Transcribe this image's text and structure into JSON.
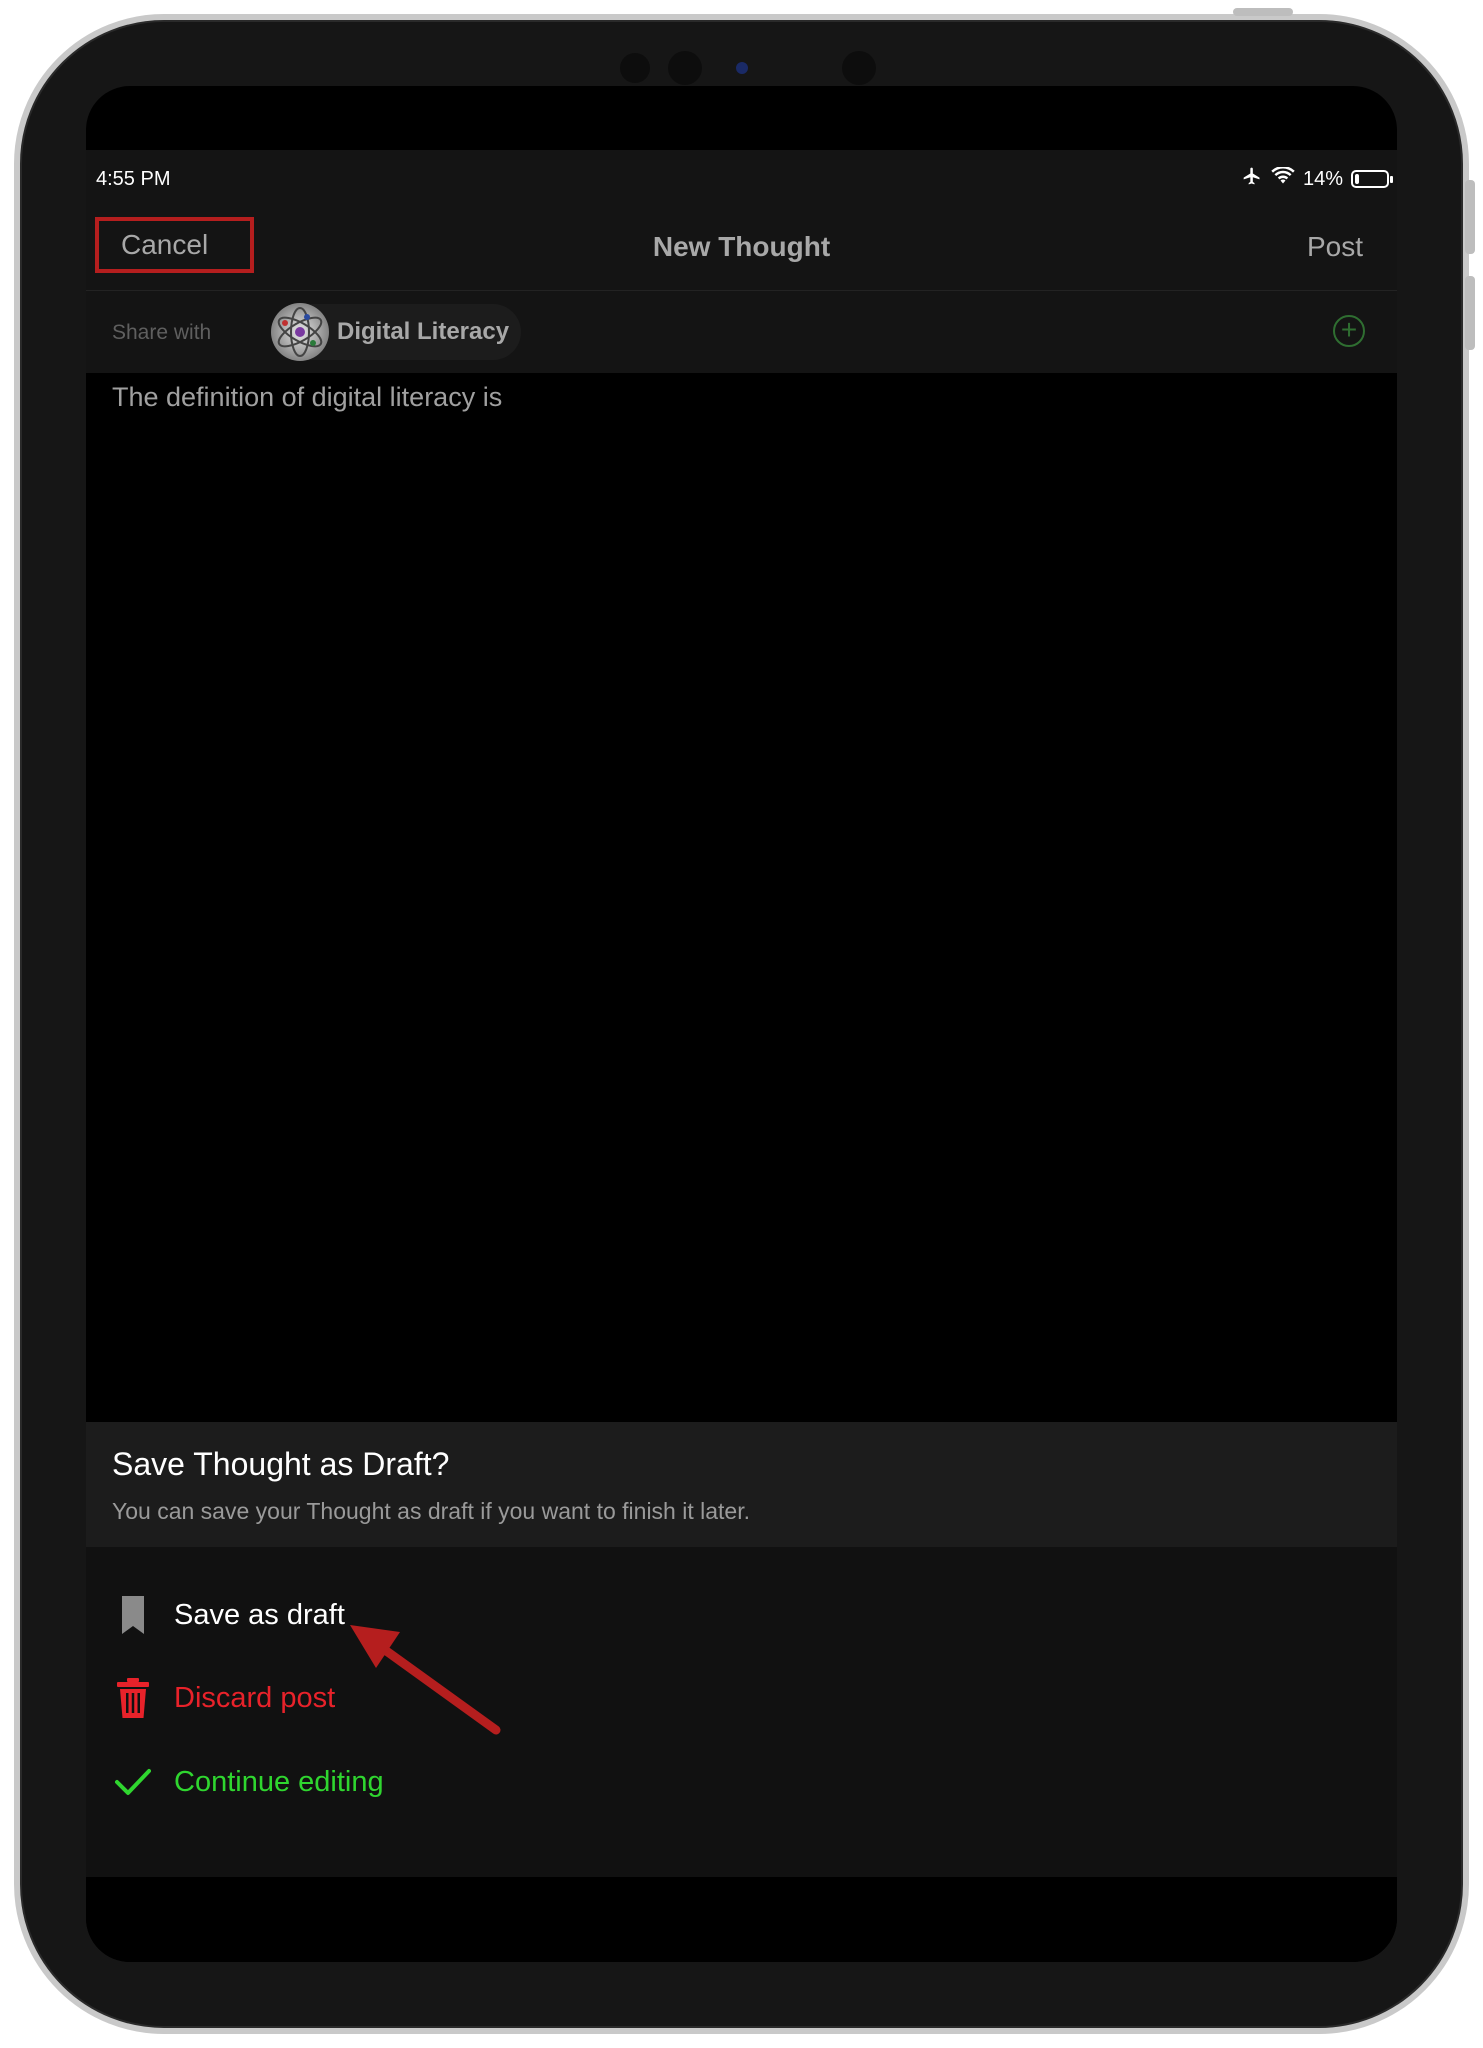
{
  "status_bar": {
    "time": "4:55 PM",
    "battery_percent_label": "14%",
    "battery_level": 0.14
  },
  "nav": {
    "cancel_label": "Cancel",
    "title": "New Thought",
    "post_label": "Post"
  },
  "share": {
    "label": "Share with",
    "group_name": "Digital Literacy"
  },
  "editor": {
    "text": "The definition of digital literacy is"
  },
  "sheet": {
    "title": "Save Thought as Draft?",
    "subtitle": "You can save your Thought as draft if you want to finish it later.",
    "actions": [
      {
        "label": "Save as draft",
        "icon": "bookmark-icon",
        "color": "#ffffff"
      },
      {
        "label": "Discard post",
        "icon": "trash-icon",
        "color": "#e8222a"
      },
      {
        "label": "Continue editing",
        "icon": "checkmark-icon",
        "color": "#2fd62f"
      }
    ]
  },
  "colors": {
    "accent_red": "#e8222a",
    "accent_green": "#2fd62f",
    "annotation_red": "#b51e1e"
  }
}
